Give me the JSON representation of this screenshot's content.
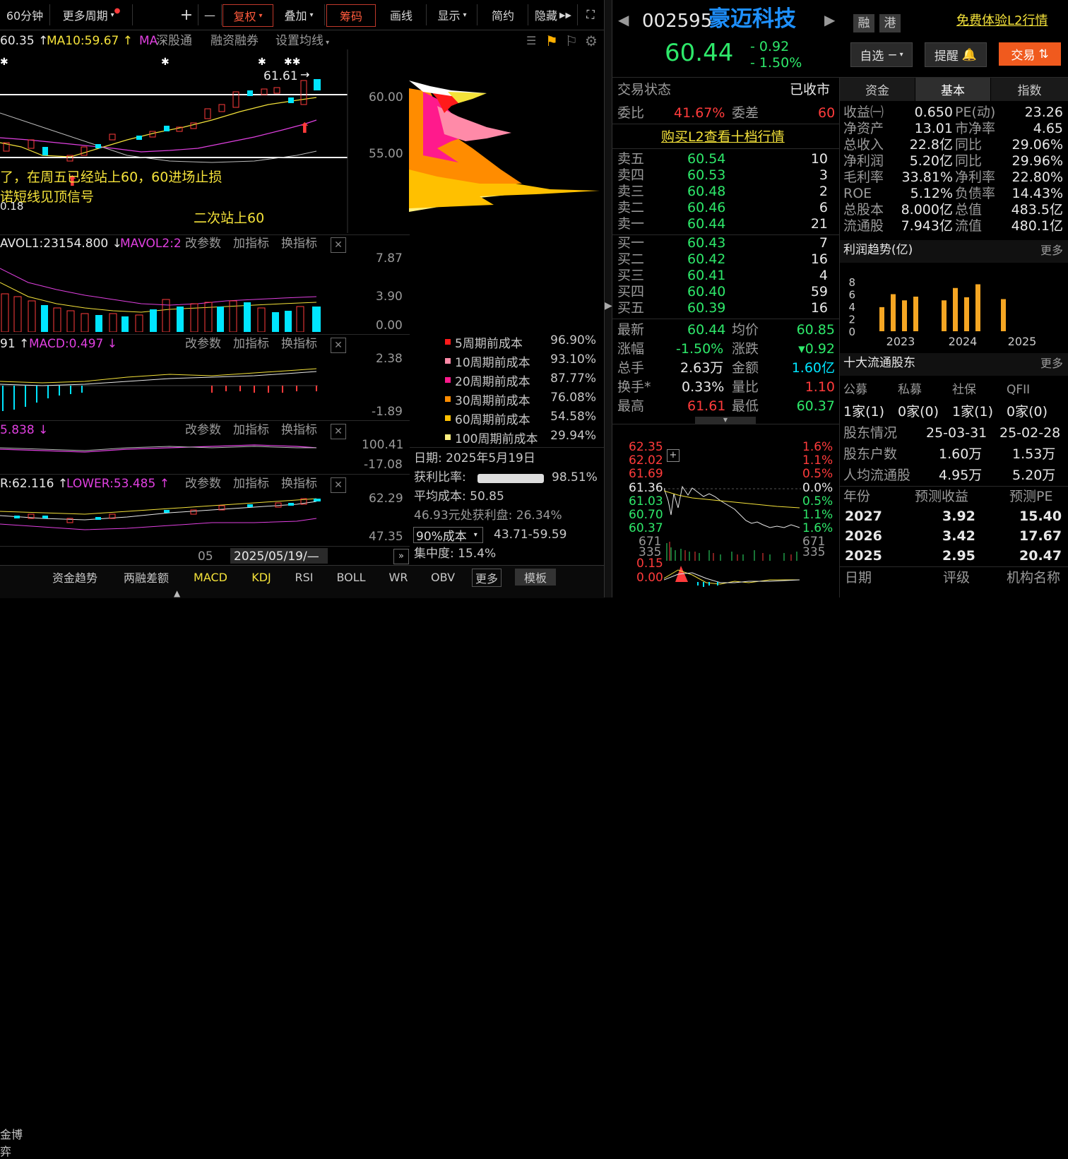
{
  "toolbar": {
    "period": "60分钟",
    "more_period": "更多周期",
    "zoom_in": "+",
    "zoom_out": "—",
    "fuquan": "复权",
    "diejia": "叠加",
    "chouma": "筹码",
    "huaxian": "画线",
    "xianshi": "显示",
    "jianyue": "简约",
    "yincang": "隐藏",
    "fullscreen": "⛶"
  },
  "ma_row": {
    "ma5": "60.35",
    "ma10": "MA10:59.67",
    "ma_label": "MA",
    "shengu": "深股通",
    "rongzi": "融资融券",
    "shezhi": "设置均线"
  },
  "chart": {
    "high_label": "61.61",
    "price_60": "60.00",
    "price_55": "55.00",
    "note1": "了，在周五已经站上60，60进场止损",
    "note2": "诺短线见顶信号",
    "note3": "二次站上60",
    "low_label": "0.18",
    "vol_label": "AVOL1:23154.800",
    "mavol2": "MAVOL2:2",
    "vol_ticks": [
      "7.87",
      "3.90",
      "0.00"
    ],
    "macd_prefix": "91",
    "macd_label": "MACD:0.497",
    "macd_ticks": [
      "2.38",
      "-1.89"
    ],
    "ind3_label": "5.838",
    "ind3_ticks": [
      "100.41",
      "-17.08"
    ],
    "boll_label": "R:62.116",
    "lower_label": "LOWER:53.485",
    "boll_ticks": [
      "62.29",
      "47.35"
    ],
    "x_label": "05",
    "date_label": "2025/05/19/—",
    "gaicanshu": "改参数",
    "jiazhibiao": "加指标",
    "huanzhibiao": "换指标"
  },
  "chips": {
    "legend": [
      {
        "label": "5周期前成本",
        "value": "96.90%",
        "color": "#ff1a1a"
      },
      {
        "label": "10周期前成本",
        "value": "93.10%",
        "color": "#ff8aa8"
      },
      {
        "label": "20周期前成本",
        "value": "87.77%",
        "color": "#ff1a8c"
      },
      {
        "label": "30周期前成本",
        "value": "76.08%",
        "color": "#ff8c00"
      },
      {
        "label": "60周期前成本",
        "value": "54.58%",
        "color": "#ffc000"
      },
      {
        "label": "100周期前成本",
        "value": "29.94%",
        "color": "#fff080"
      }
    ],
    "date": "日期: 2025年5月19日",
    "profit_label": "获利比率:",
    "profit_value": "98.51%",
    "avg_cost": "平均成本: 50.85",
    "profit_at": "46.93元处获利盘: 26.34%",
    "cost_select": "90%成本",
    "cost_range": "43.71-59.59",
    "concentration": "集中度: 15.4%"
  },
  "bottom_tabs": [
    "金博弈",
    "资金趋势",
    "两融差额",
    "MACD",
    "KDJ",
    "RSI",
    "BOLL",
    "WR",
    "OBV",
    "更多",
    "模板"
  ],
  "stock": {
    "code": "002595",
    "name": "豪迈科技",
    "price": "60.44",
    "change": "- 0.92",
    "pct": "- 1.50%",
    "tag1": "融",
    "tag2": "港",
    "l2_link": "免费体验L2行情",
    "zixuan": "自选",
    "tixing": "提醒",
    "jiaoyi": "交易"
  },
  "trade": {
    "status_label": "交易状态",
    "status_value": "已收市",
    "weibi_label": "委比",
    "weibi_value": "41.67%",
    "weicha_label": "委差",
    "weicha_value": "60",
    "buy_l2": "购买L2查看十档行情",
    "sells": [
      {
        "label": "卖五",
        "price": "60.54",
        "vol": "10"
      },
      {
        "label": "卖四",
        "price": "60.53",
        "vol": "3"
      },
      {
        "label": "卖三",
        "price": "60.48",
        "vol": "2"
      },
      {
        "label": "卖二",
        "price": "60.46",
        "vol": "6"
      },
      {
        "label": "卖一",
        "price": "60.44",
        "vol": "21"
      }
    ],
    "buys": [
      {
        "label": "买一",
        "price": "60.43",
        "vol": "7"
      },
      {
        "label": "买二",
        "price": "60.42",
        "vol": "16"
      },
      {
        "label": "买三",
        "price": "60.41",
        "vol": "4"
      },
      {
        "label": "买四",
        "price": "60.40",
        "vol": "59"
      },
      {
        "label": "买五",
        "price": "60.39",
        "vol": "16"
      }
    ],
    "stats": [
      {
        "l1": "最新",
        "v1": "60.44",
        "l2": "均价",
        "v2": "60.85"
      },
      {
        "l1": "涨幅",
        "v1": "-1.50%",
        "l2": "涨跌",
        "v2": "▾0.92"
      },
      {
        "l1": "总手",
        "v1": "2.63万",
        "l2": "金额",
        "v2": "1.60亿"
      },
      {
        "l1": "换手*",
        "v1": "0.33%",
        "l2": "量比",
        "v2": "1.10"
      },
      {
        "l1": "最高",
        "v1": "61.61",
        "l2": "最低",
        "v2": "60.37"
      }
    ]
  },
  "intraday": {
    "left_ticks": [
      "62.35",
      "62.02",
      "61.69",
      "61.36",
      "61.03",
      "60.70",
      "60.37",
      "671",
      "335",
      "0.15",
      "0.00"
    ],
    "right_ticks": [
      "1.6%",
      "1.1%",
      "0.5%",
      "0.0%",
      "0.5%",
      "1.1%",
      "1.6%",
      "671",
      "335"
    ]
  },
  "fund": {
    "tabs": [
      "资金",
      "基本",
      "指数"
    ],
    "rows": [
      {
        "l1": "收益㈠",
        "v1": "0.650",
        "l2": "PE(动)",
        "v2": "23.26"
      },
      {
        "l1": "净资产",
        "v1": "13.01",
        "l2": "市净率",
        "v2": "4.65"
      },
      {
        "l1": "总收入",
        "v1": "22.8亿",
        "l2": "同比",
        "v2": "29.06%"
      },
      {
        "l1": "净利润",
        "v1": "5.20亿",
        "l2": "同比",
        "v2": "29.96%"
      },
      {
        "l1": "毛利率",
        "v1": "33.81%",
        "l2": "净利率",
        "v2": "22.80%"
      },
      {
        "l1": "ROE",
        "v1": "5.12%",
        "l2": "负债率",
        "v2": "14.43%"
      },
      {
        "l1": "总股本",
        "v1": "8.000亿",
        "l2": "总值",
        "v2": "483.5亿"
      },
      {
        "l1": "流通股",
        "v1": "7.943亿",
        "l2": "流值",
        "v2": "480.1亿"
      }
    ],
    "profit_title": "利润趋势(亿)",
    "more": "更多",
    "profit_years": [
      "2023",
      "2024",
      "2025"
    ],
    "holders_title": "十大流通股东",
    "holder_types": [
      "公募",
      "私募",
      "社保",
      "QFII"
    ],
    "holder_counts": [
      "1家(1)",
      "0家(0)",
      "1家(1)",
      "0家(0)"
    ],
    "holder_rows": [
      {
        "l": "股东情况",
        "a": "25-03-31",
        "b": "25-02-28"
      },
      {
        "l": "股东户数",
        "a": "1.60万",
        "b": "1.53万"
      },
      {
        "l": "人均流通股",
        "a": "4.95万",
        "b": "5.20万"
      }
    ],
    "forecast_header": {
      "l": "年份",
      "a": "预测收益",
      "b": "预测PE"
    },
    "forecast_rows": [
      {
        "l": "2027",
        "a": "3.92",
        "b": "15.40"
      },
      {
        "l": "2026",
        "a": "3.42",
        "b": "17.67"
      },
      {
        "l": "2025",
        "a": "2.95",
        "b": "20.47"
      }
    ],
    "rating_header": {
      "l": "日期",
      "a": "评级",
      "b": "机构名称"
    }
  },
  "chart_data": {
    "type": "bar",
    "title": "利润趋势(亿)",
    "categories": [
      "2023",
      "2024",
      "2025"
    ],
    "y_ticks": [
      0,
      2,
      4,
      6,
      8
    ],
    "ylim": [
      0,
      8
    ],
    "series_values": [
      [
        3.9,
        6.0,
        5.0,
        5.6
      ],
      [
        5.0,
        7.0,
        5.5,
        7.6
      ],
      [
        5.2
      ]
    ]
  }
}
